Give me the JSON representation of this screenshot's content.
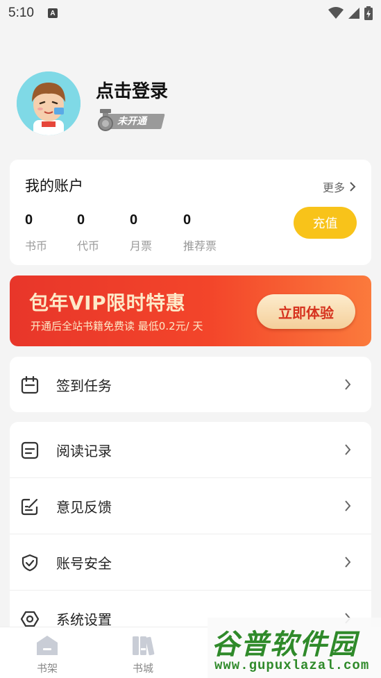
{
  "status_bar": {
    "time": "5:10",
    "notification": "A"
  },
  "profile": {
    "login_label": "点击登录",
    "vip_status": "未开通"
  },
  "account": {
    "title": "我的账户",
    "more_label": "更多",
    "stats": [
      {
        "value": "0",
        "label": "书币"
      },
      {
        "value": "0",
        "label": "代币"
      },
      {
        "value": "0",
        "label": "月票"
      },
      {
        "value": "0",
        "label": "推荐票"
      }
    ],
    "recharge_label": "充值"
  },
  "banner": {
    "title": "包年VIP限时特惠",
    "subtitle": "开通后全站书籍免费读 最低0.2元/ 天",
    "cta_label": "立即体验"
  },
  "menu": {
    "checkin": {
      "label": "签到任务",
      "icon": "calendar-icon"
    },
    "items": [
      {
        "label": "阅读记录",
        "icon": "reading-record-icon"
      },
      {
        "label": "意见反馈",
        "icon": "feedback-icon"
      },
      {
        "label": "账号安全",
        "icon": "shield-icon"
      },
      {
        "label": "系统设置",
        "icon": "settings-icon"
      }
    ]
  },
  "tabbar": {
    "tabs": [
      {
        "label": "书架",
        "icon": "bookshelf-icon"
      },
      {
        "label": "书城",
        "icon": "bookstore-icon"
      }
    ]
  },
  "watermark": {
    "title": "谷普软件园",
    "url": "www.gupuxlazal.com"
  },
  "colors": {
    "accent": "#f8c31a",
    "banner_red": "#e8362a",
    "banner_text": "#fde9c8"
  }
}
